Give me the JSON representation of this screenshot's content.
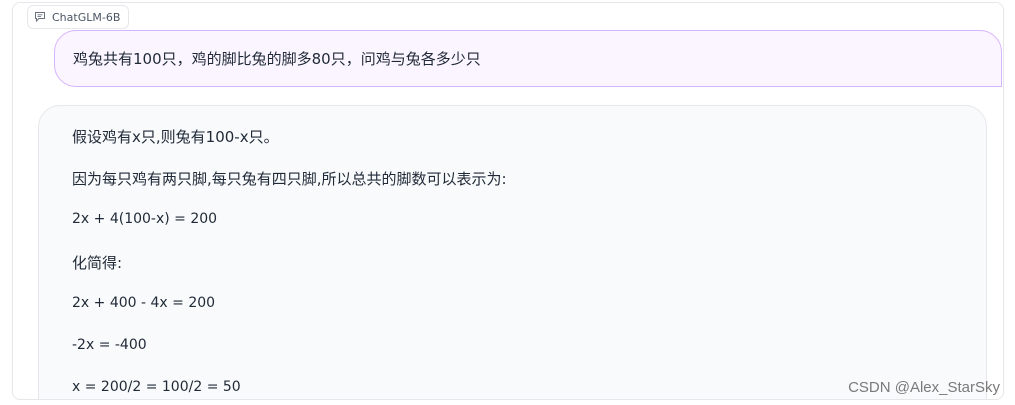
{
  "app": {
    "tag_label": "ChatGLM-6B",
    "tag_icon": "chat-bubble-icon"
  },
  "conversation": {
    "user_message": "鸡兔共有100只，鸡的脚比兔的脚多80只，问鸡与兔各多少只",
    "bot_lines": [
      "假设鸡有x只,则兔有100-x只。",
      "因为每只鸡有两只脚,每只兔有四只脚,所以总共的脚数可以表示为:",
      "2x + 4(100-x) = 200",
      "化简得:",
      "2x + 400 - 4x = 200",
      "-2x = -400",
      "x = 200/2 = 100/2 = 50"
    ]
  },
  "watermark": "CSDN @Alex_StarSky",
  "colors": {
    "user_bubble_bg": "#fbf5ff",
    "user_bubble_border": "#d8b4fe",
    "bot_bubble_bg": "#f9fafb",
    "border": "#e5e7eb",
    "text": "#1f2937"
  }
}
